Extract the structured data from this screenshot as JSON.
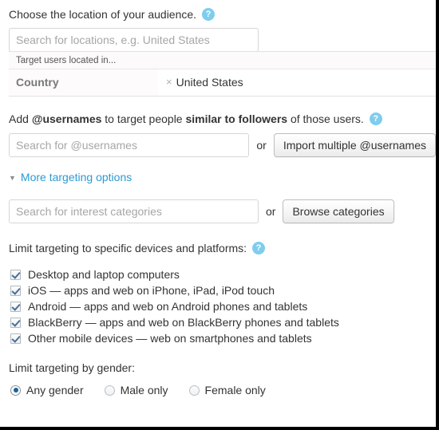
{
  "location_section": {
    "prompt_text": "Choose the location of your audience.",
    "help_icon": "help-icon",
    "help_glyph": "?",
    "search_placeholder": "Search for locations, e.g. United States",
    "search_value": "",
    "table": {
      "header_label": "Target users located in...",
      "rows": [
        {
          "category": "Country",
          "remove_glyph": "×",
          "value": "United States"
        }
      ]
    }
  },
  "usernames_section": {
    "prompt_prefix": "Add ",
    "prompt_bold_1": "@usernames",
    "prompt_middle": " to target people ",
    "prompt_bold_2": "similar to followers",
    "prompt_suffix": " of those users.",
    "help_glyph": "?",
    "search_placeholder": "Search for @usernames",
    "search_value": "",
    "or_label": "or",
    "import_button_label": "Import multiple @usernames"
  },
  "more_options": {
    "caret_glyph": "▼",
    "label": "More targeting options"
  },
  "interests_section": {
    "search_placeholder": "Search for interest categories",
    "search_value": "",
    "or_label": "or",
    "browse_button_label": "Browse categories"
  },
  "devices_section": {
    "prompt_text": "Limit targeting to specific devices and platforms:",
    "help_glyph": "?",
    "checkboxes": [
      {
        "label": "Desktop and laptop computers",
        "checked": true
      },
      {
        "label": "iOS — apps and web on iPhone, iPad, iPod touch",
        "checked": true
      },
      {
        "label": "Android — apps and web on Android phones and tablets",
        "checked": true
      },
      {
        "label": "BlackBerry — apps and web on BlackBerry phones and tablets",
        "checked": true
      },
      {
        "label": "Other mobile devices — web on smartphones and tablets",
        "checked": true
      }
    ]
  },
  "gender_section": {
    "prompt_text": "Limit targeting by gender:",
    "options": [
      {
        "label": "Any gender",
        "selected": true
      },
      {
        "label": "Male only",
        "selected": false
      },
      {
        "label": "Female only",
        "selected": false
      }
    ]
  },
  "colors": {
    "help_blue": "#7fcdee",
    "link_blue": "#2b9ad4",
    "radio_dot": "#15639c",
    "check_blue": "#4a6f94",
    "text": "#333333",
    "placeholder": "#a6a6a6",
    "border": "#d6d6d6"
  }
}
